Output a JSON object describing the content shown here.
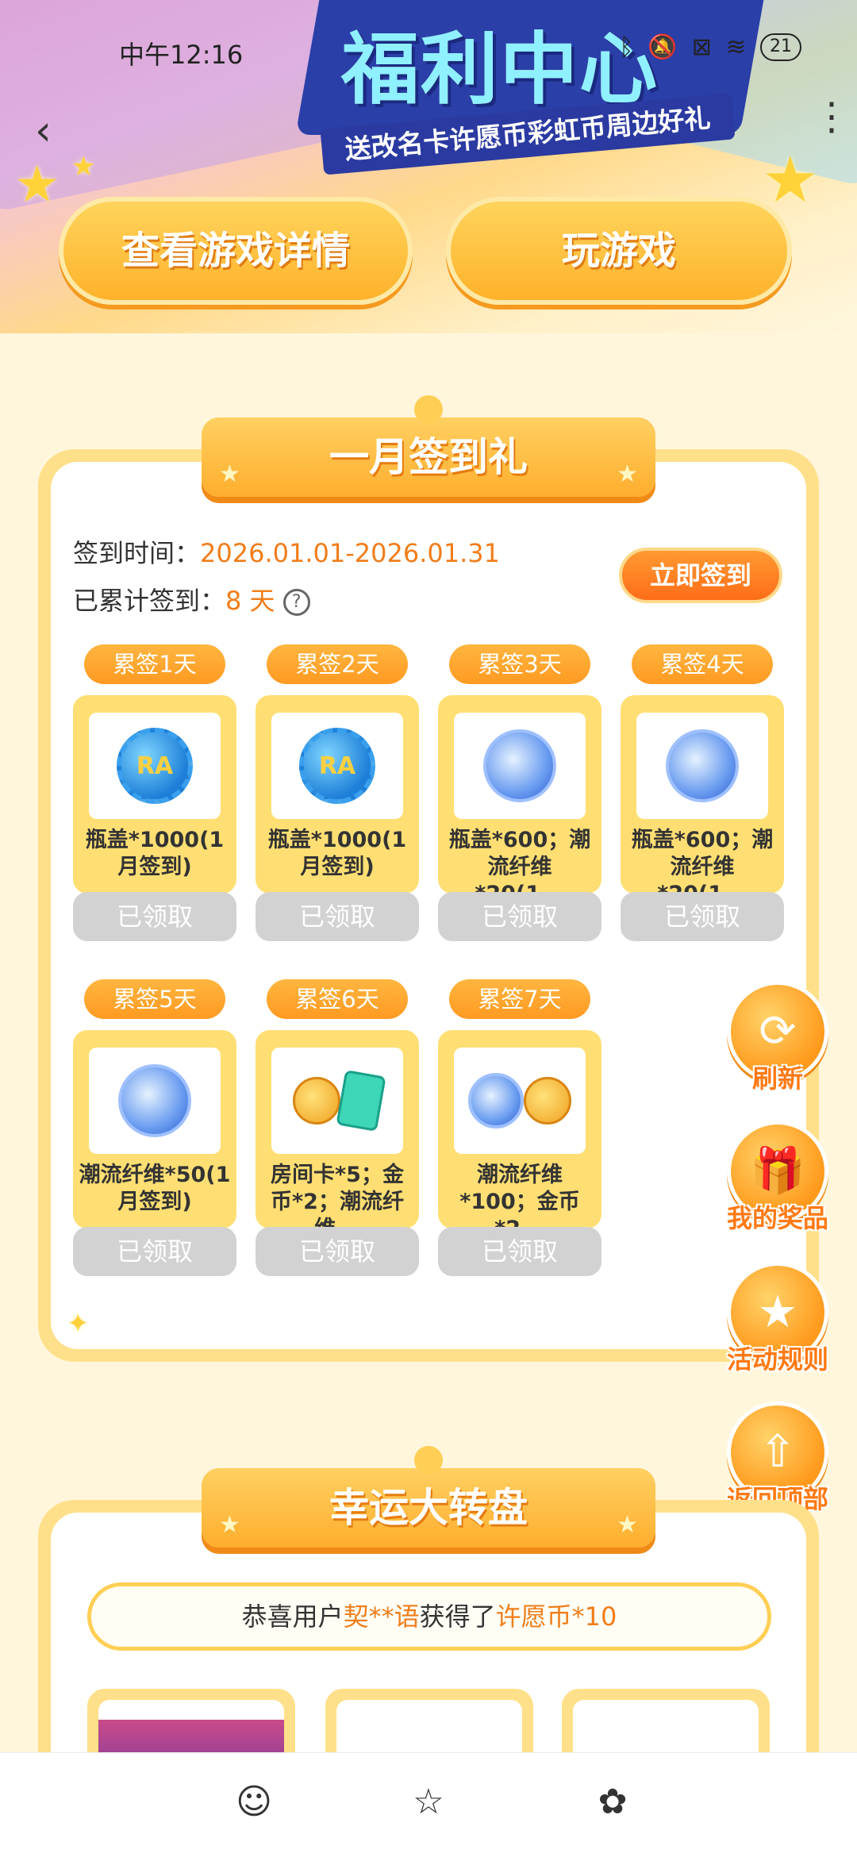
{
  "banner": {
    "title": "福利中心",
    "subtitle": "送改名卡许愿币彩虹币周边好礼"
  },
  "status_bar": {
    "time": "中午12:16",
    "icons": [
      "bluetooth-icon",
      "mute-icon",
      "sim-icon",
      "wifi-icon"
    ],
    "battery": "21"
  },
  "top_buttons": {
    "details": "查看游戏详情",
    "play": "玩游戏"
  },
  "signin": {
    "title": "一月签到礼",
    "time_label": "签到时间：",
    "time_value": "2026.01.01-2026.01.31",
    "count_label": "已累计签到：",
    "count_value": "8 天",
    "button": "立即签到",
    "rewards": [
      {
        "day": "累签1天",
        "name": "瓶盖*1000(1月签到)",
        "status": "已领取",
        "icon": "bottle-cap-icon"
      },
      {
        "day": "累签2天",
        "name": "瓶盖*1000(1月签到)",
        "status": "已领取",
        "icon": "bottle-cap-icon"
      },
      {
        "day": "累签3天",
        "name": "瓶盖*600；潮流纤维*20(1...",
        "status": "已领取",
        "icon": "fiber-cap-icon"
      },
      {
        "day": "累签4天",
        "name": "瓶盖*600；潮流纤维*20(1...",
        "status": "已领取",
        "icon": "fiber-cap-icon"
      },
      {
        "day": "累签5天",
        "name": "潮流纤维*50(1月签到)",
        "status": "已领取",
        "icon": "fiber-icon"
      },
      {
        "day": "累签6天",
        "name": "房间卡*5；金币*2；潮流纤维...",
        "status": "已领取",
        "icon": "room-card-coin-icon"
      },
      {
        "day": "累签7天",
        "name": "潮流纤维*100；金币*2...",
        "status": "已领取",
        "icon": "fiber-coin-icon"
      }
    ]
  },
  "side_buttons": {
    "refresh": "刷新",
    "my_prizes": "我的奖品",
    "rules": "活动规则",
    "top": "返回顶部"
  },
  "wheel": {
    "title": "幸运大转盘",
    "notice_prefix": "恭喜用户",
    "notice_user": "契**语",
    "notice_mid": "获得了",
    "notice_prize": "许愿币*10"
  },
  "bottom_nav": [
    "home-face-icon",
    "star-icon",
    "flower-icon"
  ],
  "colors": {
    "accent": "#f07d1a",
    "gold": "#ffb22b",
    "claimed": "#d2d2d2"
  }
}
